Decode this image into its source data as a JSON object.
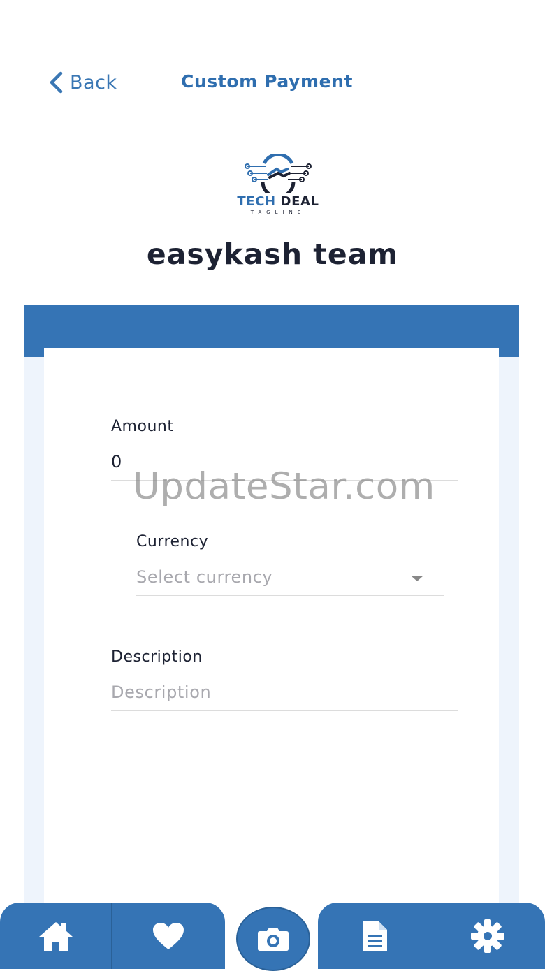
{
  "header": {
    "back_label": "Back",
    "title": "Custom Payment"
  },
  "logo": {
    "name_part1": "TECH",
    "name_part2": " DEAL",
    "tagline": "TAGLINE"
  },
  "merchant_name": "easykash team",
  "form": {
    "amount": {
      "label": "Amount",
      "value": "0"
    },
    "currency": {
      "label": "Currency",
      "placeholder": "Select currency"
    },
    "description": {
      "label": "Description",
      "placeholder": "Description"
    }
  },
  "watermark": "UpdateStar.com",
  "nav": {
    "items": [
      "home-icon",
      "heart-icon",
      "camera-icon",
      "document-icon",
      "gear-icon"
    ]
  },
  "colors": {
    "accent": "#3574B5",
    "title": "#2F6EAF",
    "text": "#1d2233",
    "placeholder": "#a8a8ae"
  }
}
